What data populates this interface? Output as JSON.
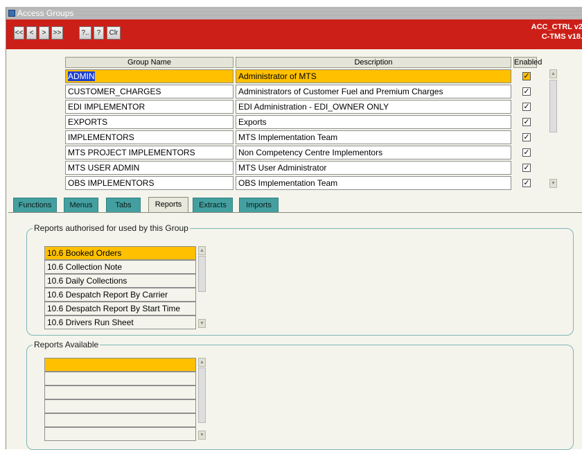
{
  "window": {
    "title": "Access Groups"
  },
  "toolbar": {
    "buttons": [
      "<<",
      "<",
      ">",
      ">>",
      "?..",
      "?",
      "Clr"
    ],
    "module": "ACC_CTRL v2",
    "version": "C-TMS v18."
  },
  "groups_grid": {
    "columns": [
      "Group Name",
      "Description",
      "Enabled"
    ],
    "rows": [
      {
        "name": "ADMIN",
        "description": "Administrator of MTS",
        "enabled": true
      },
      {
        "name": "CUSTOMER_CHARGES",
        "description": "Administrators of Customer Fuel and Premium Charges",
        "enabled": true
      },
      {
        "name": "EDI IMPLEMENTOR",
        "description": "EDI Administration - EDI_OWNER ONLY",
        "enabled": true
      },
      {
        "name": "EXPORTS",
        "description": "Exports",
        "enabled": true
      },
      {
        "name": "IMPLEMENTORS",
        "description": "MTS Implementation Team",
        "enabled": true
      },
      {
        "name": "MTS PROJECT IMPLEMENTORS",
        "description": "Non Competency Centre Implementors",
        "enabled": true
      },
      {
        "name": "MTS USER ADMIN",
        "description": "MTS User Administrator",
        "enabled": true
      },
      {
        "name": "OBS IMPLEMENTORS",
        "description": "OBS Implementation Team",
        "enabled": true
      }
    ],
    "check_mark": "✓"
  },
  "tabs": [
    "Functions",
    "Menus",
    "Tabs",
    "Reports",
    "Extracts",
    "Imports"
  ],
  "active_tab": "Reports",
  "reports_authorised": {
    "title": "Reports authorised for used by this Group",
    "items": [
      "10.6 Booked Orders",
      "10.6 Collection Note",
      "10.6 Daily Collections",
      "10.6 Despatch Report By Carrier",
      "10.6 Despatch Report By Start Time",
      "10.6 Drivers Run Sheet"
    ]
  },
  "reports_available": {
    "title": "Reports Available",
    "items": [
      "",
      "",
      "",
      "",
      "",
      ""
    ]
  },
  "colors": {
    "toolbar_red": "#cc1f18",
    "selection_yellow": "#ffc000",
    "tab_teal": "#44a0a0",
    "highlight_blue": "#1d3fd0"
  }
}
